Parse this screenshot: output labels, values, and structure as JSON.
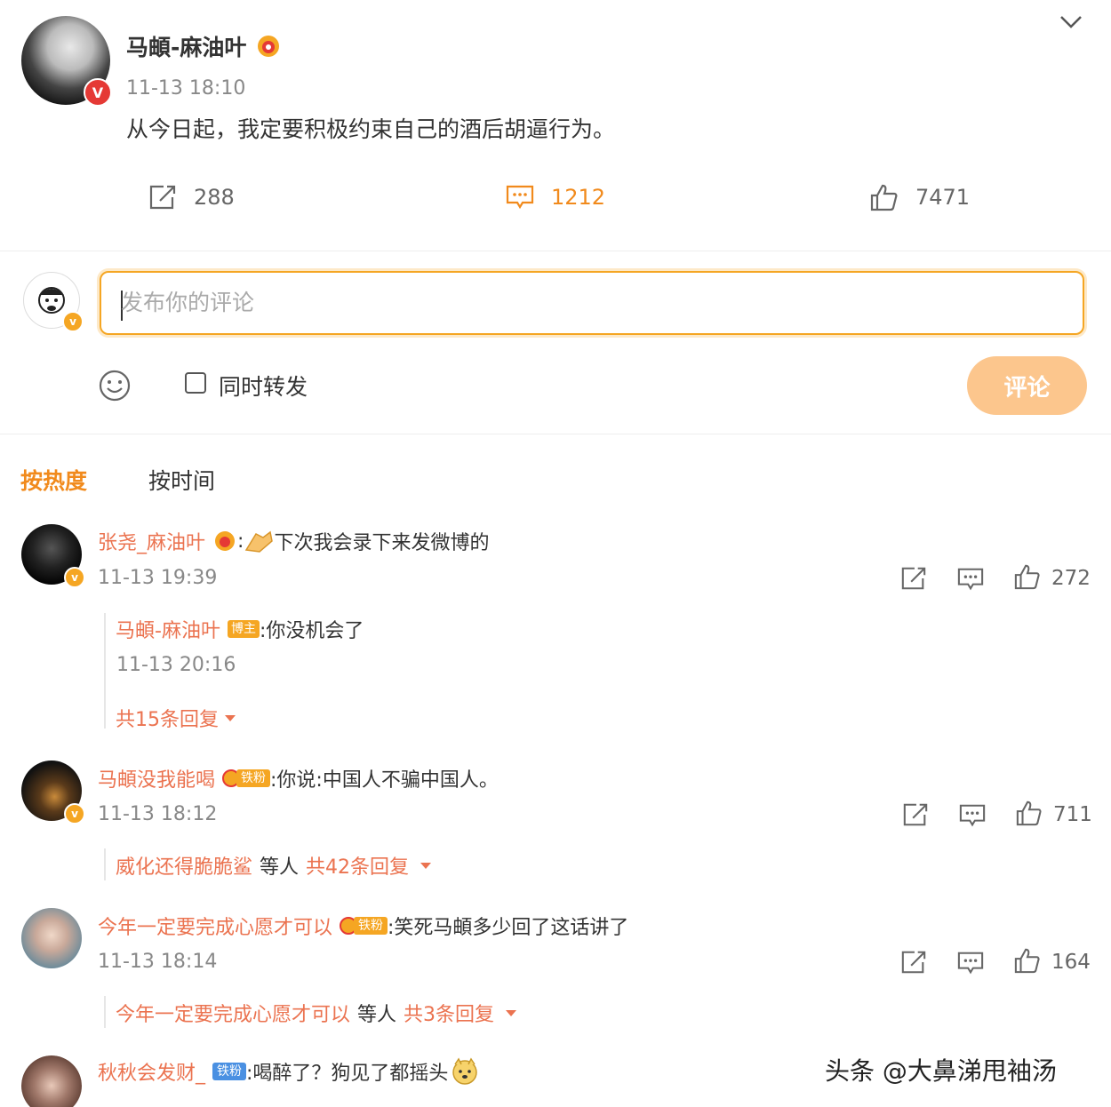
{
  "post": {
    "author": "马頔-麻油叶",
    "time": "11-13 18:10",
    "text": "从今日起，我定要积极约束自己的酒后胡逼行为。",
    "reposts": "288",
    "comments": "1212",
    "likes": "7471"
  },
  "composer": {
    "placeholder": "发布你的评论",
    "repost_label": "同时转发",
    "submit_label": "评论"
  },
  "tabs": {
    "hot": "按热度",
    "time": "按时间"
  },
  "comments": [
    {
      "name": "张尧_麻油叶",
      "text": "下次我会录下来发微博的",
      "time": "11-13 19:39",
      "likes": "272",
      "reply": {
        "name": "马頔-麻油叶",
        "badge": "博主",
        "text": ":你没机会了",
        "time": "11-13 20:16",
        "more": "共15条回复"
      }
    },
    {
      "name": "马頔没我能喝",
      "badge": "铁粉",
      "text": ":你说:中国人不骗中国人。",
      "time": "11-13 18:12",
      "likes": "711",
      "summary_name": "威化还得脆脆鲨",
      "summary_mid": "等人",
      "summary_count": "共42条回复"
    },
    {
      "name": "今年一定要完成心愿才可以",
      "badge": "铁粉",
      "text": ":笑死马頔多少回了这话讲了",
      "time": "11-13 18:14",
      "likes": "164",
      "summary_name": "今年一定要完成心愿才可以",
      "summary_mid": "等人",
      "summary_count": "共3条回复"
    },
    {
      "name": "秋秋会发财_",
      "badge": "铁粉",
      "text": ":喝醉了？狗见了都摇头"
    }
  ],
  "watermark": "头条 @大鼻涕甩袖汤",
  "colors": {
    "accent": "#f18a1c",
    "name": "#eb7350",
    "button": "#fcc68d"
  }
}
